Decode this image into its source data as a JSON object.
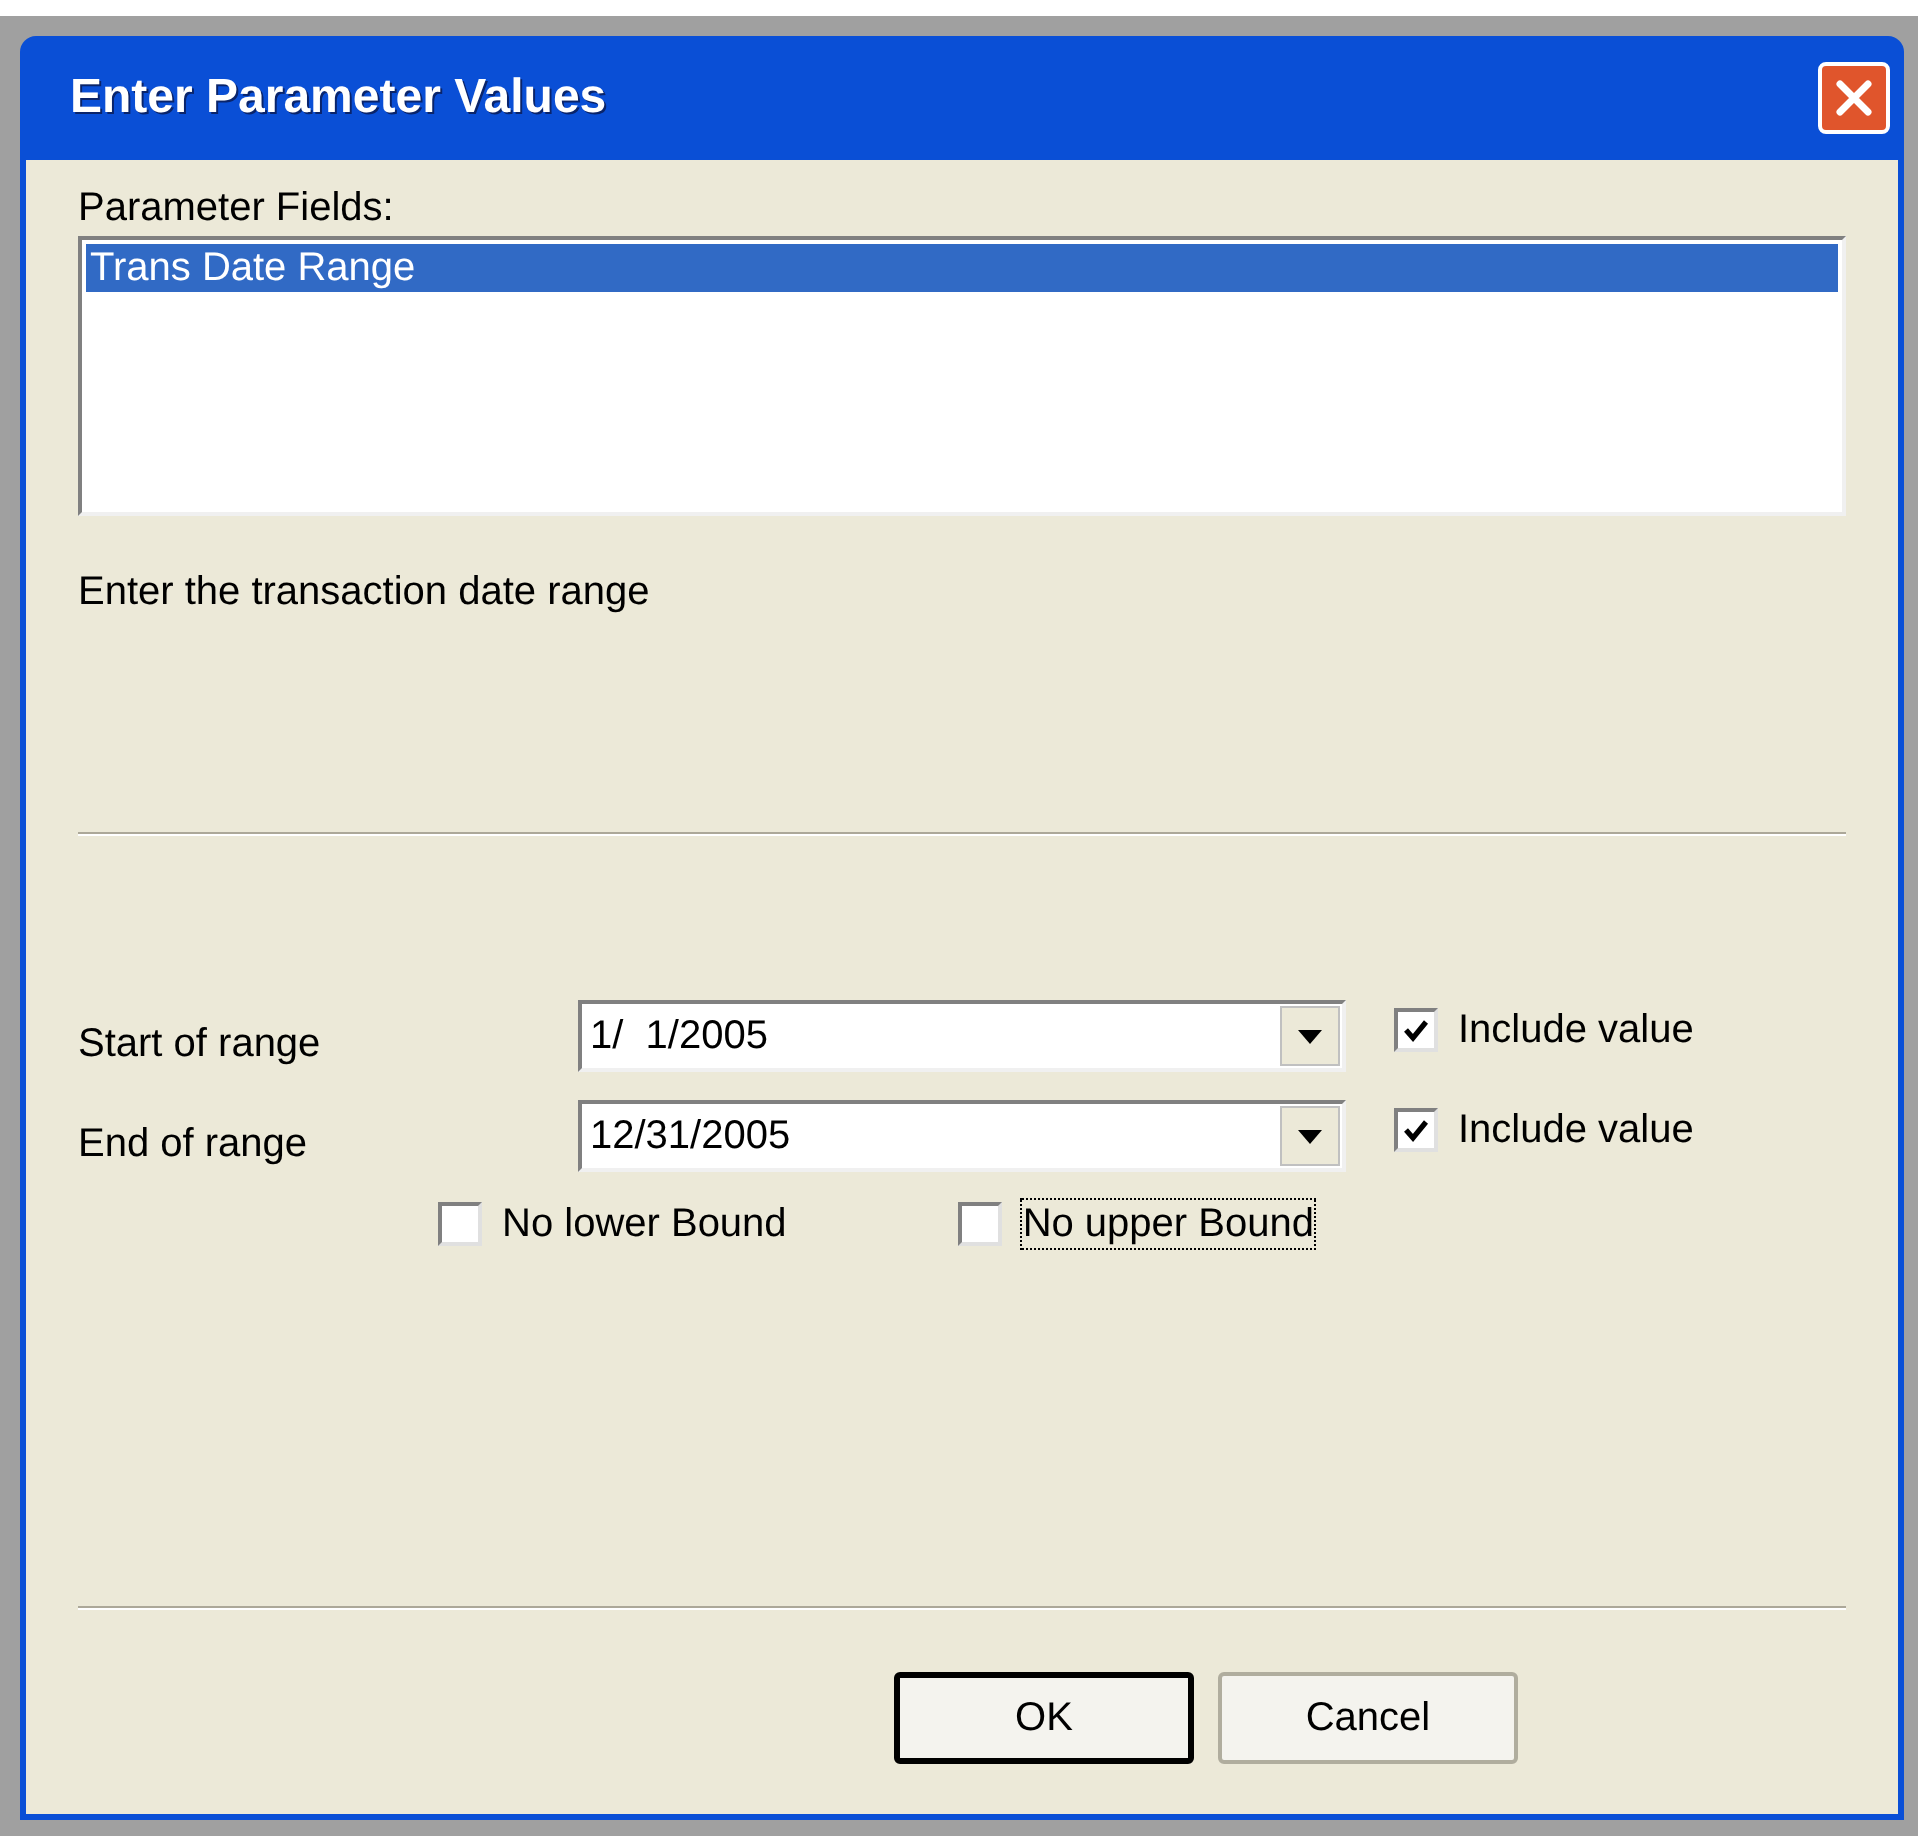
{
  "window": {
    "title": "Enter Parameter Values"
  },
  "parameter_fields": {
    "label": "Parameter Fields:",
    "items": [
      {
        "label": "Trans Date Range",
        "selected": true
      }
    ]
  },
  "description": "Enter the transaction date range",
  "range": [
    {
      "label": "Start of range",
      "value": "1/  1/2005",
      "include": {
        "label": "Include value",
        "checked": true
      }
    },
    {
      "label": "End of range",
      "value": "12/31/2005",
      "include": {
        "label": "Include value",
        "checked": true
      }
    }
  ],
  "bounds": [
    {
      "label": "No lower Bound",
      "checked": false,
      "focused": false
    },
    {
      "label": "No upper Bound",
      "checked": false,
      "focused": true
    }
  ],
  "buttons": [
    {
      "label": "OK",
      "default": true
    },
    {
      "label": "Cancel",
      "default": false
    }
  ]
}
